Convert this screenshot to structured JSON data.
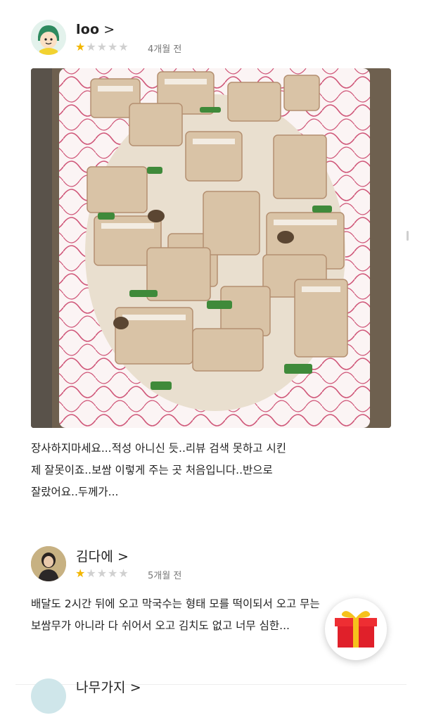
{
  "reviews": [
    {
      "user": "loo",
      "chevron": ">",
      "rating": 1,
      "ago": "4개월 전",
      "text": "장사하지마세요...적성 아니신 듯..리뷰 검색 못하고 시킨\n제 잘못이죠..보쌈 이렇게 주는 곳 처음입니다..반으로\n잘랐어요..두께가..."
    },
    {
      "user": "김다에",
      "chevron": ">",
      "rating": 1,
      "ago": "5개월 전",
      "text": "배달도 2시간 뒤에 오고 막국수는 형태 모를 떡이되서 오고 무는\n보쌈무가 아니라 다 쉬어서 오고 김치도 없고 너무 심한..."
    },
    {
      "user": "나무가지",
      "chevron": ">"
    }
  ],
  "icons": {
    "star_filled": "★",
    "star_empty": "★",
    "gift": "gift-icon"
  },
  "colors": {
    "star_on": "#f2b600",
    "star_off": "#d0d0d0",
    "gift_red": "#e0202a",
    "gift_ribbon": "#f6c21c"
  }
}
